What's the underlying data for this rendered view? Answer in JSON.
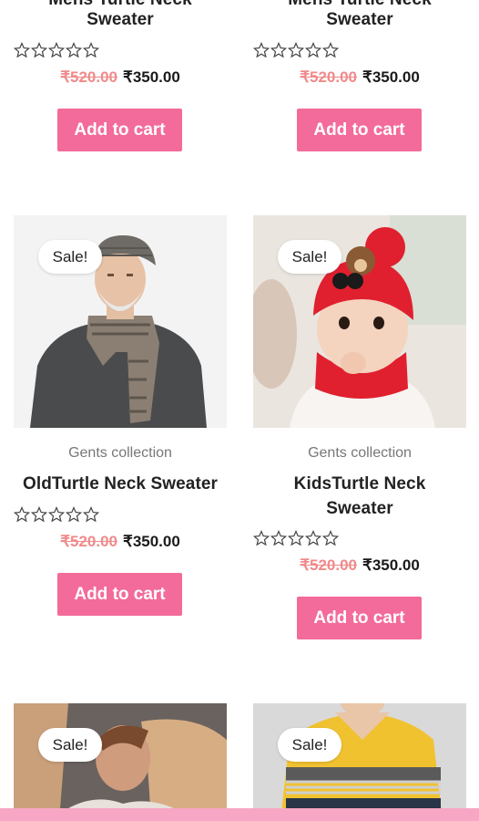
{
  "colors": {
    "accent": "#f36b9a",
    "old_price": "#f08a8a",
    "bottom_bar": "#f7a6c4"
  },
  "products": [
    {
      "title_line1": "Mens Turtle Neck",
      "title_line2": "Sweater",
      "rating": 0,
      "old_price": "₹520.00",
      "new_price": "₹350.00",
      "button": "Add to cart"
    },
    {
      "title_line1": "Mens Turtle Neck",
      "title_line2": "Sweater",
      "rating": 0,
      "old_price": "₹520.00",
      "new_price": "₹350.00",
      "button": "Add to cart"
    },
    {
      "sale": "Sale!",
      "category": "Gents collection",
      "title_line1": "OldTurtle Neck Sweater",
      "rating": 0,
      "old_price": "₹520.00",
      "new_price": "₹350.00",
      "button": "Add to cart"
    },
    {
      "sale": "Sale!",
      "category": "Gents collection",
      "title_line1": "KidsTurtle Neck",
      "title_line2": "Sweater",
      "rating": 0,
      "old_price": "₹520.00",
      "new_price": "₹350.00",
      "button": "Add to cart"
    },
    {
      "sale": "Sale!"
    },
    {
      "sale": "Sale!"
    }
  ]
}
